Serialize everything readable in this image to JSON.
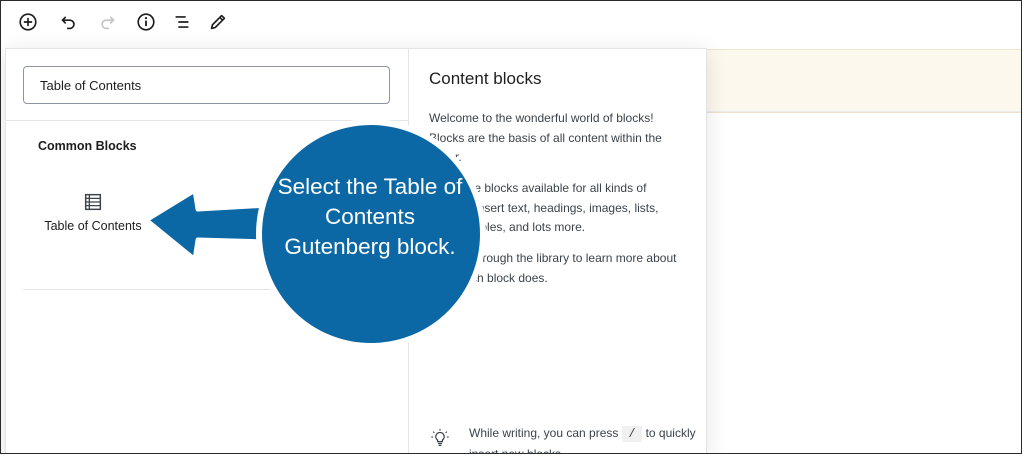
{
  "toolbar": {
    "items": [
      {
        "name": "add-block",
        "icon": "plus-circle-icon"
      },
      {
        "name": "undo",
        "icon": "undo-icon"
      },
      {
        "name": "redo",
        "icon": "redo-icon",
        "disabled": true
      },
      {
        "name": "content-structure",
        "icon": "info-icon"
      },
      {
        "name": "block-navigation",
        "icon": "list-outline-icon"
      },
      {
        "name": "tools",
        "icon": "pencil-icon"
      }
    ]
  },
  "inserter": {
    "search": {
      "value": "Table of Contents"
    },
    "category_heading": "Common Blocks",
    "blocks": [
      {
        "label": "Table of Contents",
        "icon": "table-of-contents-icon"
      }
    ]
  },
  "help_panel": {
    "title": "Content blocks",
    "paragraphs": [
      "Welcome to the wonderful world of blocks! Blocks are the basis of all content within the editor.",
      "There are blocks available for all kinds of content: insert text, headings, images, lists, videos, tables, and lots more.",
      "Browse through the library to learn more about what each block does."
    ],
    "tip": {
      "icon": "lightbulb-icon",
      "before": "While writing, you can press",
      "key": "/",
      "after": "to quickly insert new blocks."
    }
  },
  "annotation": {
    "text": "Select the Table of Contents Gutenberg block.",
    "circle_color": "#0c67a5",
    "arrow_color": "#0c67a5"
  }
}
